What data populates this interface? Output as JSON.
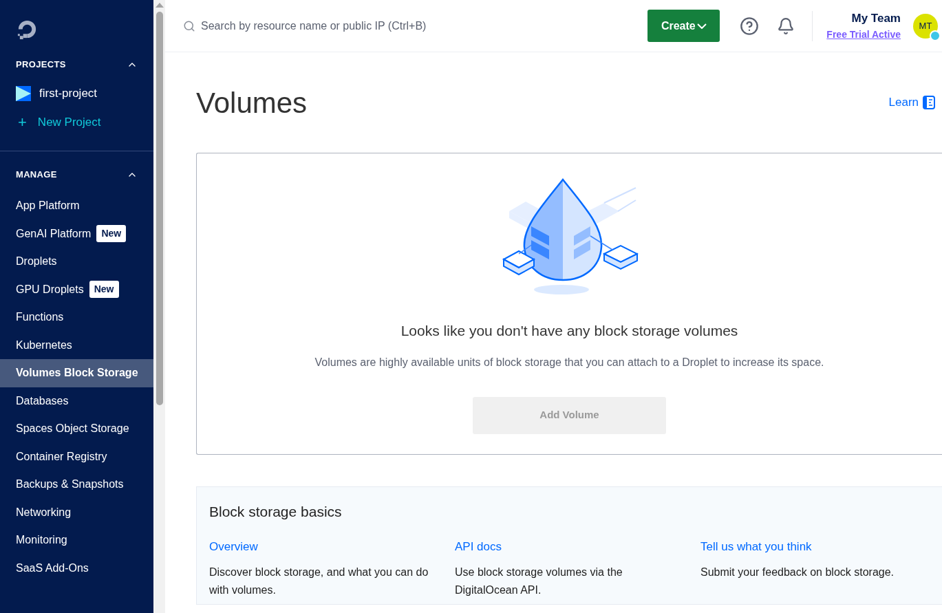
{
  "sidebar": {
    "projects": {
      "heading": "PROJECTS",
      "expanded": true,
      "items": [
        {
          "label": "first-project"
        }
      ],
      "new_project": {
        "icon": "+",
        "label": "New Project"
      }
    },
    "manage": {
      "heading": "MANAGE",
      "expanded": true,
      "items": [
        {
          "label": "App Platform",
          "selected": false
        },
        {
          "label": "GenAI Platform",
          "selected": false,
          "badge": "New"
        },
        {
          "label": "Droplets",
          "selected": false
        },
        {
          "label": "GPU Droplets",
          "selected": false,
          "badge": "New"
        },
        {
          "label": "Functions",
          "selected": false
        },
        {
          "label": "Kubernetes",
          "selected": false
        },
        {
          "label": "Volumes Block Storage",
          "selected": true
        },
        {
          "label": "Databases",
          "selected": false
        },
        {
          "label": "Spaces Object Storage",
          "selected": false
        },
        {
          "label": "Container Registry",
          "selected": false
        },
        {
          "label": "Backups & Snapshots",
          "selected": false
        },
        {
          "label": "Networking",
          "selected": false
        },
        {
          "label": "Monitoring",
          "selected": false
        },
        {
          "label": "SaaS Add-Ons",
          "selected": false
        }
      ]
    }
  },
  "header": {
    "search": {
      "placeholder": "Search by resource name or public IP (Ctrl+B)"
    },
    "create_button": "Create",
    "team": {
      "name": "My Team",
      "status": "Free Trial Active",
      "initials": "MT"
    }
  },
  "page": {
    "title": "Volumes",
    "learn_link": "Learn",
    "empty_state": {
      "heading": "Looks like you don't have any block storage volumes",
      "description": "Volumes are highly available units of block storage that you can attach to a Droplet to increase its space.",
      "button": {
        "label": "Add Volume",
        "disabled": true
      }
    },
    "basics": {
      "title": "Block storage basics",
      "columns": [
        {
          "link": "Overview",
          "text": "Discover block storage, and what you can do with volumes."
        },
        {
          "link": "API docs",
          "text": "Use block storage volumes via the DigitalOcean API."
        },
        {
          "link": "Tell us what you think",
          "text": "Submit your feedback on block storage."
        }
      ]
    }
  }
}
